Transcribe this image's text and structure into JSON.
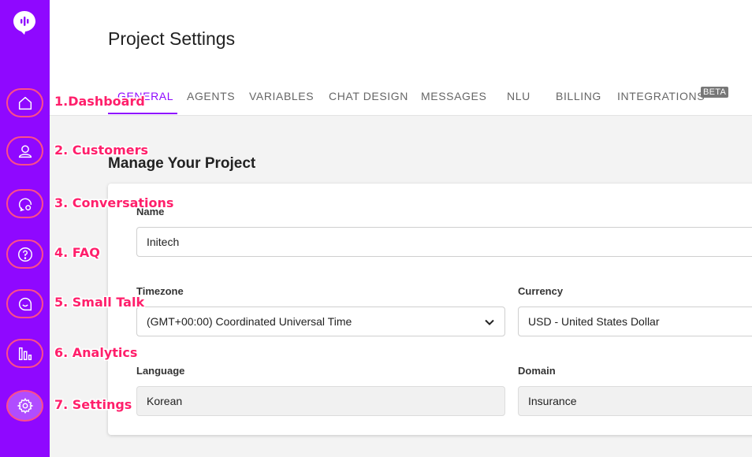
{
  "sidebar": {
    "brand_color": "#8f08ff",
    "logo_icon": "chat-bubble-logo-icon",
    "items": [
      {
        "icon": "home-icon",
        "callout": "1.Dashboard"
      },
      {
        "icon": "user-icon",
        "callout": "2. Customers"
      },
      {
        "icon": "chat-bubble-icon",
        "callout": "3. Conversations"
      },
      {
        "icon": "question-icon",
        "callout": "4. FAQ"
      },
      {
        "icon": "smile-chat-icon",
        "callout": "5. Small Talk"
      },
      {
        "icon": "bar-chart-icon",
        "callout": "6. Analytics"
      },
      {
        "icon": "gear-icon",
        "callout": "7. Settings"
      }
    ]
  },
  "header": {
    "title": "Project Settings",
    "tabs": [
      "GENERAL",
      "AGENTS",
      "VARIABLES",
      "CHAT DESIGN",
      "MESSAGES",
      "NLU",
      "BILLING",
      "INTEGRATIONS"
    ],
    "active_tab": "GENERAL",
    "beta_badge": "BETA"
  },
  "main": {
    "section_title": "Manage Your Project",
    "form": {
      "name": {
        "label": "Name",
        "value": "Initech"
      },
      "timezone": {
        "label": "Timezone",
        "value": "(GMT+00:00) Coordinated Universal Time"
      },
      "currency": {
        "label": "Currency",
        "value": "USD - United States Dollar"
      },
      "language": {
        "label": "Language",
        "value": "Korean"
      },
      "domain": {
        "label": "Domain",
        "value": "Insurance"
      }
    }
  },
  "colors": {
    "accent": "#8f08ff",
    "callout": "#ff1f6b"
  }
}
